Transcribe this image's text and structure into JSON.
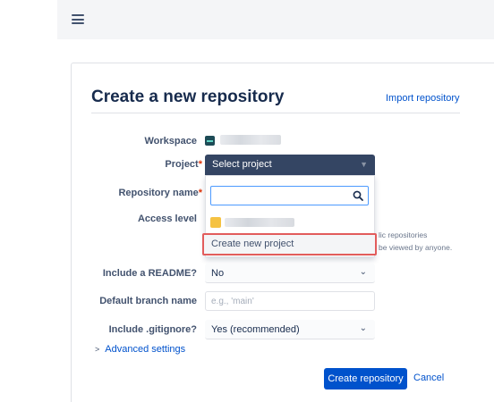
{
  "header": {
    "menu_icon": "hamburger-icon"
  },
  "page": {
    "title": "Create a new repository",
    "import_link": "Import repository"
  },
  "form": {
    "workspace_label": "Workspace",
    "project_label": "Project",
    "project_value": "Select project",
    "required_mark": "*",
    "repo_name_label": "Repository name",
    "access_label": "Access level",
    "access_desc_1": "lic repositories",
    "access_desc_2": "be viewed by anyone.",
    "readme_label": "Include a README?",
    "readme_value": "No",
    "branch_label": "Default branch name",
    "branch_placeholder": "e.g., 'main'",
    "gitignore_label": "Include .gitignore?",
    "gitignore_value": "Yes (recommended)",
    "advanced": "Advanced settings"
  },
  "dropdown": {
    "search_value": "",
    "create_new": "Create new project"
  },
  "buttons": {
    "create": "Create repository",
    "cancel": "Cancel"
  },
  "colors": {
    "accent": "#0052cc",
    "select_dark": "#344563",
    "highlight_border": "#e25c5c"
  }
}
